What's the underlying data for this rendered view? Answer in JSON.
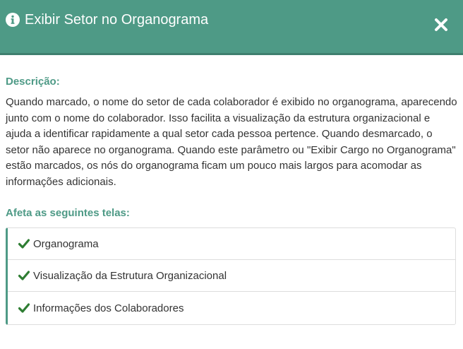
{
  "modal": {
    "title": "Exibir Setor no Organograma",
    "title_icon": "info-circle-icon",
    "close_icon": "close-icon",
    "header_color": "#4e9a86"
  },
  "description": {
    "label": "Descrição:",
    "text": "Quando marcado, o nome do setor de cada colaborador é exibido no organograma, aparecendo junto com o nome do colaborador. Isso facilita a visualização da estrutura organizacional e ajuda a identificar rapidamente a qual setor cada pessoa pertence. Quando desmarcado, o setor não aparece no organograma. Quando este parâmetro ou \"Exibir Cargo no Organograma\" estão marcados, os nós do organograma ficam um pouco mais largos para acomodar as informações adicionais."
  },
  "affects": {
    "label": "Afeta as seguintes telas:",
    "item_icon": "check-icon",
    "check_color": "#2e7d32",
    "items": [
      {
        "label": "Organograma"
      },
      {
        "label": "Visualização da Estrutura Organizacional"
      },
      {
        "label": "Informações dos Colaboradores"
      }
    ]
  }
}
